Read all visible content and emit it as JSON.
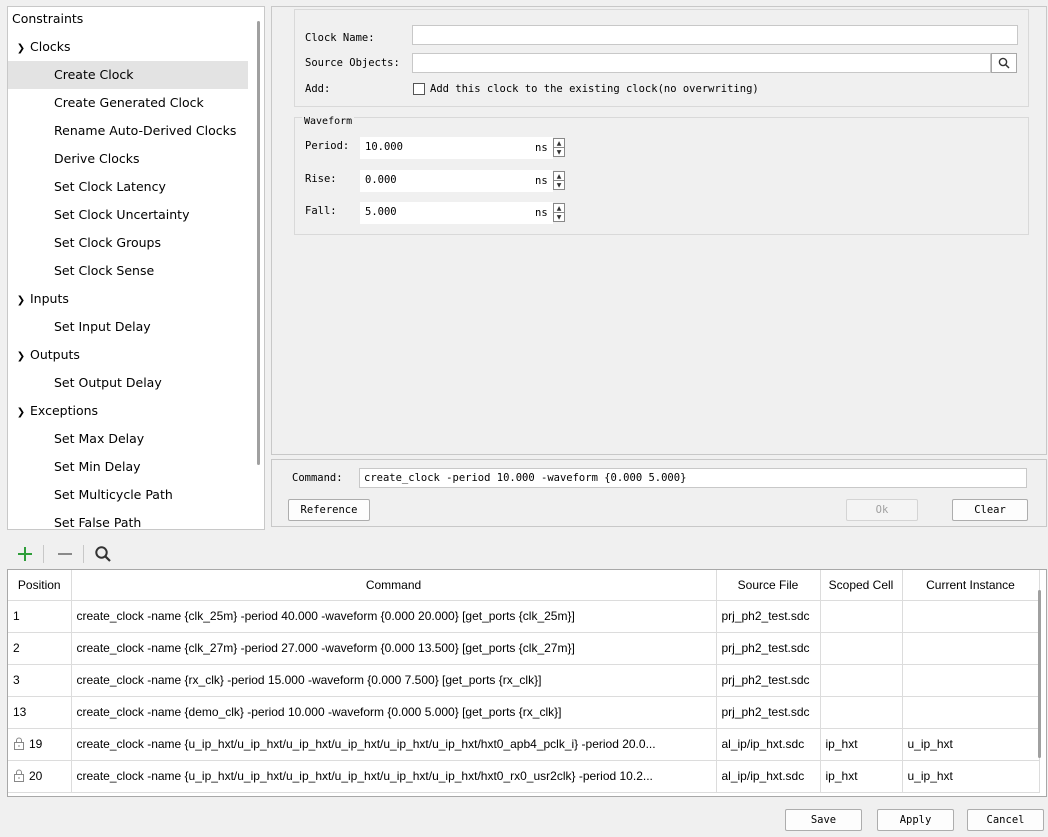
{
  "tree": {
    "root": "Constraints",
    "groups": [
      {
        "label": "Clocks",
        "items": [
          "Create Clock",
          "Create Generated Clock",
          "Rename Auto-Derived Clocks",
          "Derive Clocks",
          "Set Clock Latency",
          "Set Clock Uncertainty",
          "Set Clock Groups",
          "Set Clock Sense"
        ]
      },
      {
        "label": "Inputs",
        "items": [
          "Set Input Delay"
        ]
      },
      {
        "label": "Outputs",
        "items": [
          "Set Output Delay"
        ]
      },
      {
        "label": "Exceptions",
        "items": [
          "Set Max Delay",
          "Set Min Delay",
          "Set Multicycle Path",
          "Set False Path"
        ]
      }
    ],
    "selected": "Create Clock"
  },
  "form": {
    "clock_name_label": "Clock Name:",
    "clock_name_value": "",
    "source_objects_label": "Source Objects:",
    "source_objects_value": "",
    "add_label": "Add:",
    "add_checkbox_label": "Add this clock to the existing clock(no overwriting)",
    "add_checked": false,
    "waveform_title": "Waveform",
    "period_label": "Period:",
    "period_value": "10.000",
    "rise_label": "Rise:",
    "rise_value": "0.000",
    "fall_label": "Fall:",
    "fall_value": "5.000",
    "unit": "ns"
  },
  "command": {
    "label": "Command:",
    "value": "create_clock -period 10.000 -waveform {0.000 5.000}",
    "reference_button": "Reference",
    "ok_button": "Ok",
    "clear_button": "Clear"
  },
  "toolbar": {
    "add_icon": "plus-icon",
    "remove_icon": "minus-icon",
    "search_icon": "search-icon"
  },
  "table": {
    "columns": [
      "Position",
      "Command",
      "Source File",
      "Scoped Cell",
      "Current Instance"
    ],
    "rows": [
      {
        "position": "1",
        "locked": false,
        "command": "create_clock -name {clk_25m} -period 40.000 -waveform {0.000 20.000} [get_ports {clk_25m}]",
        "source": "prj_ph2_test.sdc",
        "scoped": "",
        "instance": ""
      },
      {
        "position": "2",
        "locked": false,
        "command": "create_clock -name {clk_27m} -period 27.000 -waveform {0.000 13.500} [get_ports {clk_27m}]",
        "source": "prj_ph2_test.sdc",
        "scoped": "",
        "instance": ""
      },
      {
        "position": "3",
        "locked": false,
        "command": "create_clock -name {rx_clk} -period 15.000 -waveform {0.000 7.500} [get_ports {rx_clk}]",
        "source": "prj_ph2_test.sdc",
        "scoped": "",
        "instance": ""
      },
      {
        "position": "13",
        "locked": false,
        "command": "create_clock -name {demo_clk} -period 10.000 -waveform {0.000 5.000} [get_ports {rx_clk}]",
        "source": "prj_ph2_test.sdc",
        "scoped": "",
        "instance": ""
      },
      {
        "position": "19",
        "locked": true,
        "command": "create_clock -name {u_ip_hxt/u_ip_hxt/u_ip_hxt/u_ip_hxt/u_ip_hxt/u_ip_hxt/hxt0_apb4_pclk_i} -period 20.0...",
        "source": "al_ip/ip_hxt.sdc",
        "scoped": "ip_hxt",
        "instance": "u_ip_hxt"
      },
      {
        "position": "20",
        "locked": true,
        "command": "create_clock -name {u_ip_hxt/u_ip_hxt/u_ip_hxt/u_ip_hxt/u_ip_hxt/u_ip_hxt/hxt0_rx0_usr2clk} -period 10.2...",
        "source": "al_ip/ip_hxt.sdc",
        "scoped": "ip_hxt",
        "instance": "u_ip_hxt"
      }
    ]
  },
  "bottom": {
    "save_button": "Save",
    "apply_button": "Apply",
    "cancel_button": "Cancel"
  },
  "colors": {
    "plus": "#2e9e3a",
    "minus": "#8a8a8a",
    "selected_row": "#e3e3e3"
  }
}
